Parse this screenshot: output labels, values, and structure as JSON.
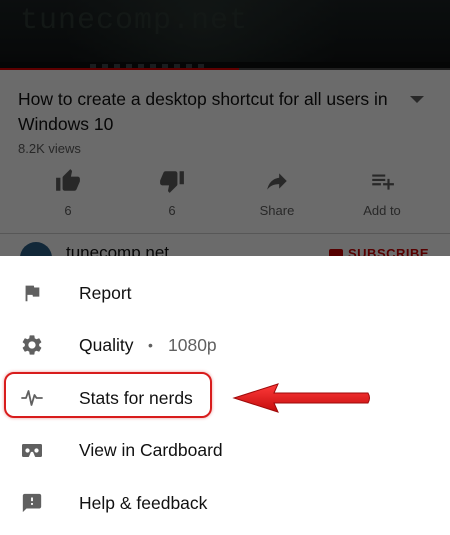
{
  "video": {
    "watermark": "tunecomp.net",
    "progress_fraction": 0.53
  },
  "info": {
    "title": "How to create a desktop shortcut for all users in Windows 10",
    "views": "8.2K views",
    "actions": [
      {
        "icon": "thumbs-up-icon",
        "label": "6"
      },
      {
        "icon": "thumbs-down-icon",
        "label": "6"
      },
      {
        "icon": "share-icon",
        "label": "Share"
      },
      {
        "icon": "add-to-playlist-icon",
        "label": "Add to"
      }
    ],
    "channel_name": "tunecomp.net",
    "subscribe_label": "SUBSCRIBE"
  },
  "menu": {
    "items": [
      {
        "icon": "flag-icon",
        "label": "Report"
      },
      {
        "icon": "gear-icon",
        "label": "Quality",
        "value": "1080p",
        "separator": "•"
      },
      {
        "icon": "pulse-icon",
        "label": "Stats for nerds"
      },
      {
        "icon": "cardboard-icon",
        "label": "View in Cardboard"
      },
      {
        "icon": "feedback-icon",
        "label": "Help & feedback"
      }
    ]
  },
  "colors": {
    "accent_red": "#d81c1c",
    "brand_red": "#cc0000",
    "icon_gray": "#606060"
  }
}
